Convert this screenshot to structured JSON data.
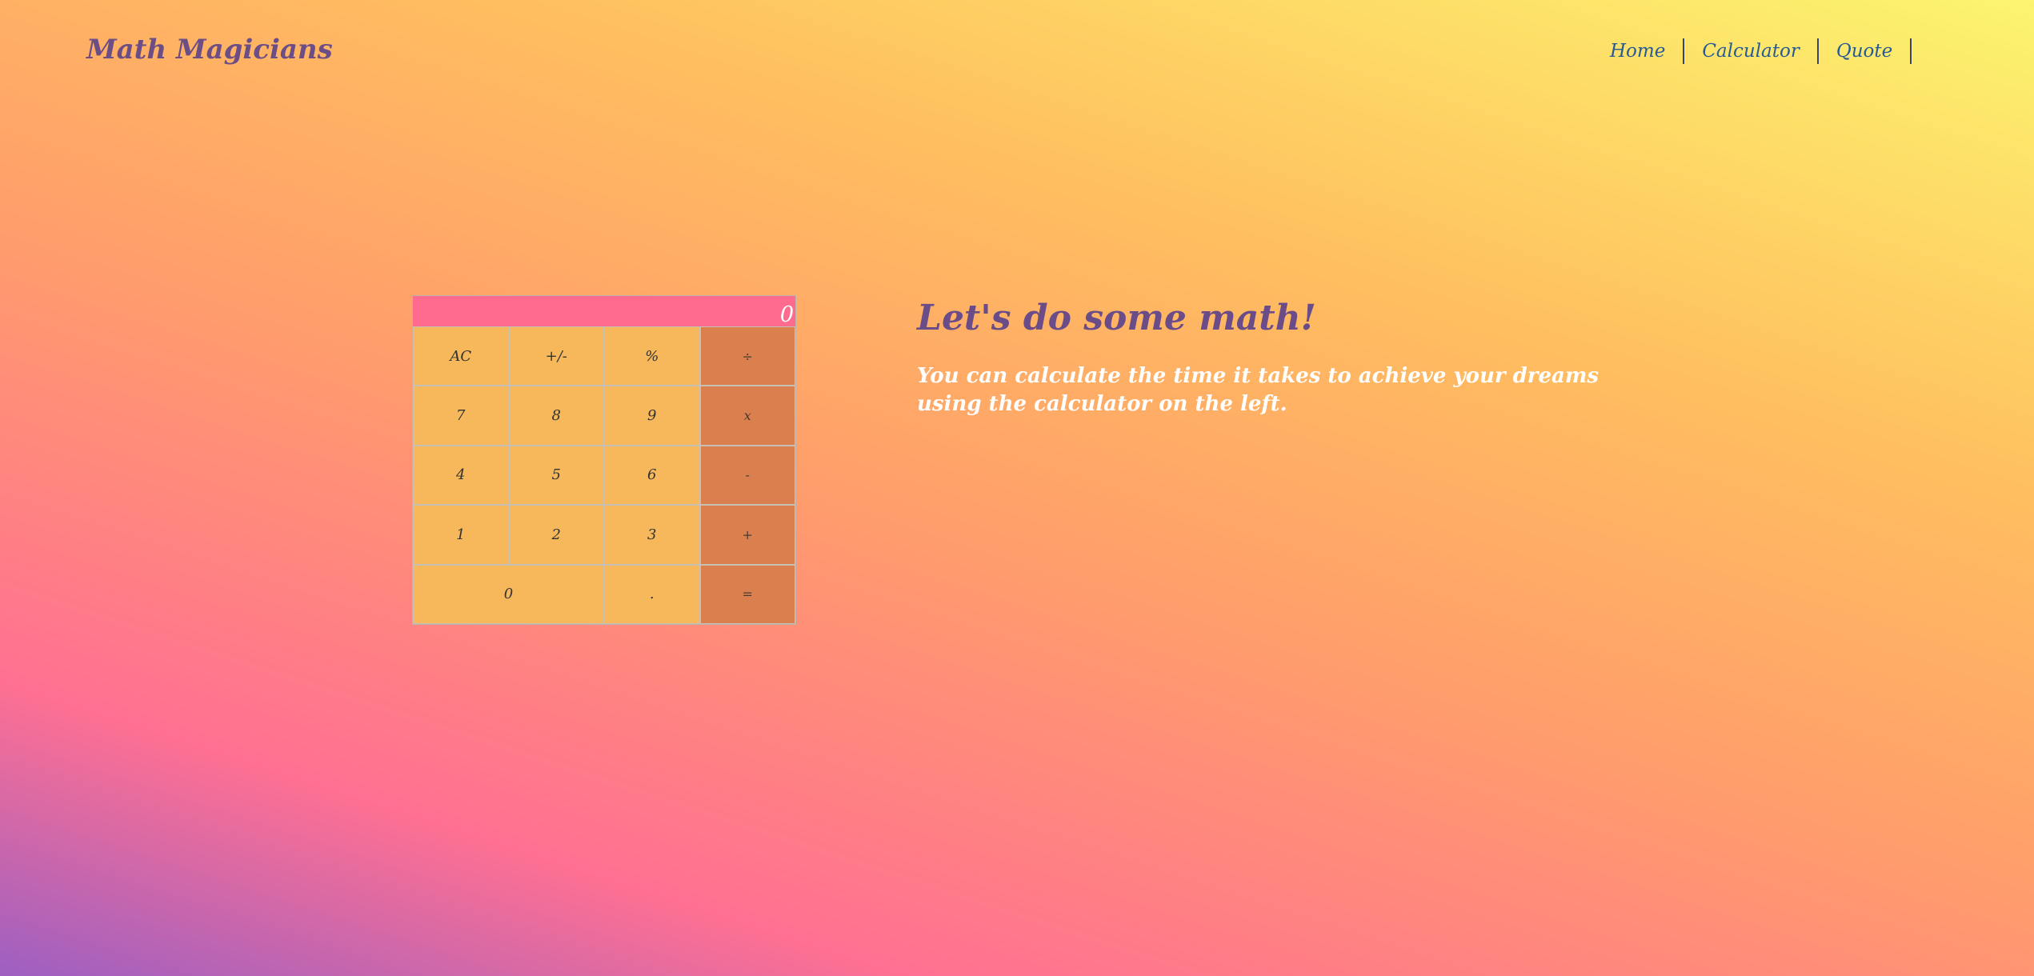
{
  "header": {
    "brand": "Math Magicians",
    "nav": [
      "Home",
      "Calculator",
      "Quote"
    ]
  },
  "calculator": {
    "display": "0",
    "keys": [
      "AC",
      "+/-",
      "%",
      "÷",
      "7",
      "8",
      "9",
      "x",
      "4",
      "5",
      "6",
      "-",
      "1",
      "2",
      "3",
      "+",
      "0",
      ".",
      "="
    ]
  },
  "hero": {
    "title": "Let's do some math!",
    "text": "You can calculate the time it takes to achieve your dreams using the calculator on the left."
  },
  "colors": {
    "brand": "#6b4e86",
    "nav_link": "#275b96",
    "display_bg": "#ff6b8f",
    "key_bg": "#f6b85a",
    "operator_bg": "#d9804e",
    "hero_text": "#ffffff"
  }
}
